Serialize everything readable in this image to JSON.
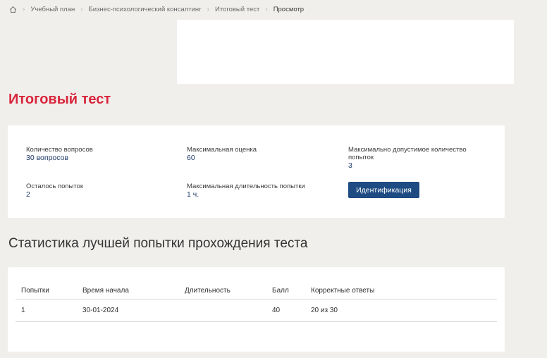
{
  "breadcrumb": {
    "items": [
      "Учебный план",
      "Бизнес-психологический консалтинг",
      "Итоговый тест"
    ],
    "current": "Просмотр"
  },
  "page_title": "Итоговый тест",
  "info": {
    "questions_label": "Количество вопросов",
    "questions_value": "30 вопросов",
    "max_score_label": "Максимальная оценка",
    "max_score_value": "60",
    "max_attempts_label": "Максимально допустимое количество попыток",
    "max_attempts_value": "3",
    "remaining_label": "Осталось попыток",
    "remaining_value": "2",
    "max_duration_label": "Максимальная длительность попытки",
    "max_duration_value": "1 ч.",
    "ident_button": "Идентификация"
  },
  "stats": {
    "title": "Статистика лучшей попытки прохождения теста",
    "columns": [
      "Попытки",
      "Время начала",
      "Длительность",
      "Балл",
      "Корректные ответы"
    ],
    "rows": [
      [
        "1",
        "30-01-2024",
        "",
        "40",
        "20 из 30"
      ]
    ]
  }
}
